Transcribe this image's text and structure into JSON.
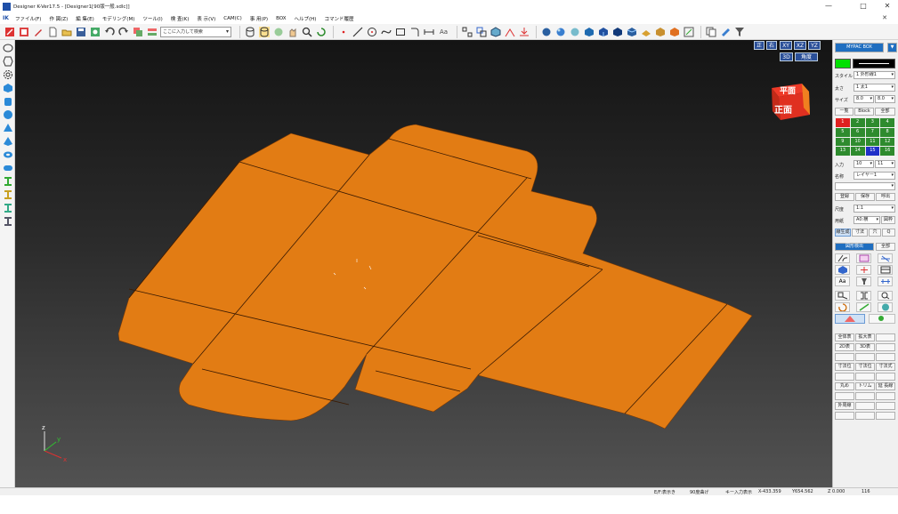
{
  "window": {
    "title": "Designer K-Ver17.5 - [Designer1[90版一般.sdlc]]",
    "controls": {
      "minimize": "—",
      "maximize": "□",
      "close": "✕"
    }
  },
  "menu": {
    "items": [
      "ファイル(F)",
      "作 図(Z)",
      "編 集(E)",
      "モデリング(M)",
      "ツール(I)",
      "検 査(K)",
      "表 示(V)",
      "CAM(C)",
      "事 用(P)",
      "BOX",
      "ヘルプ(H)",
      "コマンド履歴"
    ],
    "sub_close": "✕"
  },
  "toolbar": {
    "search_placeholder": "ここに入力して検索",
    "text_tool_label": "Aa"
  },
  "viewport": {
    "view_buttons": [
      "正",
      "右",
      "XY",
      "XZ",
      "YZ"
    ],
    "mode_buttons": [
      "3D",
      "角度"
    ],
    "view_cube": {
      "top_label": "平面",
      "front_label": "正面",
      "face_color": "#e03020"
    },
    "axes": {
      "x": "x",
      "y": "y",
      "z": "z"
    },
    "model_color": "#e27c14",
    "background_top": "#141414",
    "background_bottom": "#525252"
  },
  "right_panel": {
    "header": "MYPAC BOX",
    "color_swatch": "#00e000",
    "style_label": "スタイル",
    "style_value": "1 外形線1",
    "linetype_label": "太さ",
    "linetype_value": "1 太1",
    "size_label": "サイズ",
    "size_value": "8.0",
    "size_value2": "8.0",
    "layer_tabs": [
      "一覧",
      "Block",
      "全部"
    ],
    "layer_numbers": [
      "1",
      "2",
      "3",
      "4",
      "5",
      "6",
      "7",
      "8",
      "9",
      "10",
      "11",
      "12",
      "13",
      "14",
      "15",
      "16"
    ],
    "input_label": "入力",
    "input_value": "10",
    "input_value2": "11",
    "name_label": "名称",
    "name_value": "レイヤー1",
    "buttons_row1": [
      "登録",
      "保存",
      "呼出"
    ],
    "scale_label": "尺度",
    "scale_value": "1:1",
    "paper_label": "用紙",
    "paper_value": "A0:横",
    "paper_btn": "図枠",
    "tabs_row": [
      "線生成",
      "寸法",
      "穴",
      "Q"
    ],
    "sub_tabs": [
      "図形検出",
      "全部"
    ],
    "text_tool": "Aa",
    "function_rows": [
      [
        "全体表",
        "拡大表"
      ],
      [
        "2D表",
        "3D表"
      ],
      [
        "寸法位",
        "寸法位",
        "寸法式"
      ],
      [
        "丸め",
        "トリム",
        "延 長線"
      ],
      [
        "外周線"
      ]
    ]
  },
  "status_bar": {
    "mode": "E/F:表示き",
    "snap": "90度曲げ",
    "input_hint": "キー入力表示",
    "x_coord": "X-433.359",
    "y_coord": "Y654.562",
    "z_coord": "Z 0.000",
    "count": "116"
  }
}
